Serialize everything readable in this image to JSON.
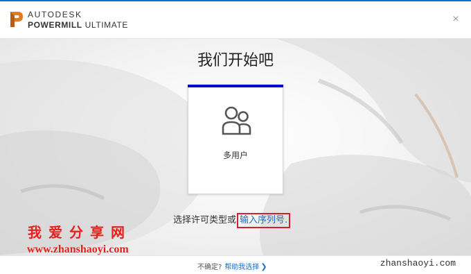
{
  "app": {
    "brand_line1": "AUTODESK",
    "brand_line2_bold": "POWERMILL",
    "brand_line2_rest": " ULTIMATE",
    "close_glyph": "×"
  },
  "main": {
    "title": "我们开始吧",
    "card": {
      "icon": "multi-user-icon",
      "label": "多用户"
    },
    "license_prefix": "选择许可类型或",
    "serial_link": "输入序列号."
  },
  "watermark": {
    "chinese": "我爱分享网",
    "url": "www.zhanshaoyi.com",
    "corner": "zhanshaoyi.com"
  },
  "footer": {
    "question": "不确定?",
    "help_link": "帮助我选择",
    "chevron": "❯"
  },
  "colors": {
    "accent_top": "#0d6fce",
    "card_top_bar": "#0000cc",
    "link": "#1a6fc4",
    "highlight_box": "#d1222a",
    "watermark_red": "#e8201c",
    "logo_orange": "#e07b21"
  }
}
